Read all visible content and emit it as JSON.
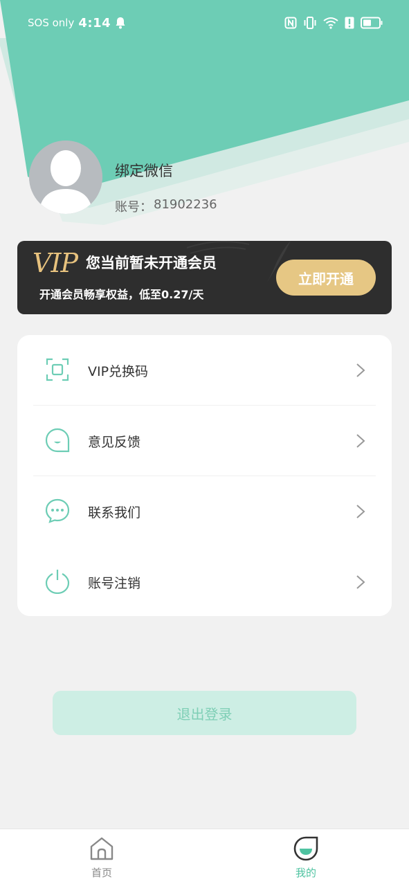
{
  "colors": {
    "accent": "#6dcdb5",
    "vip_gold": "#e6c784",
    "logout_bg": "#cdeee4"
  },
  "status_bar": {
    "carrier": "SOS only",
    "time": "4:14"
  },
  "profile": {
    "name": "绑定微信",
    "account_label": "账号：",
    "account_number": "81902236"
  },
  "vip_banner": {
    "logo_text": "VIP",
    "title": "您当前暂未开通会员",
    "subtitle": "开通会员畅享权益，低至0.27/天",
    "button_label": "立即开通"
  },
  "menu": {
    "items": [
      {
        "label": "VIP兑换码",
        "icon": "scan-icon"
      },
      {
        "label": "意见反馈",
        "icon": "feedback-icon"
      },
      {
        "label": "联系我们",
        "icon": "chat-icon"
      },
      {
        "label": "账号注销",
        "icon": "power-icon"
      }
    ]
  },
  "logout": {
    "label": "退出登录"
  },
  "bottom_nav": {
    "items": [
      {
        "label": "首页",
        "icon": "home-icon",
        "active": false
      },
      {
        "label": "我的",
        "icon": "mine-icon",
        "active": true
      }
    ]
  }
}
